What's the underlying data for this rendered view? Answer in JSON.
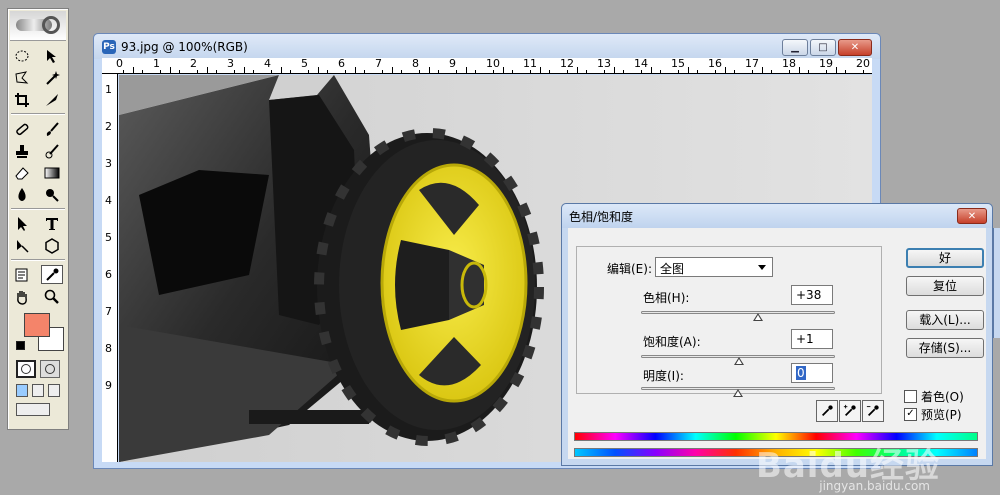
{
  "document": {
    "title": "93.jpg @ 100%(RGB)",
    "ruler_h": [
      "0",
      "1",
      "2",
      "3",
      "4",
      "5",
      "6",
      "7",
      "8",
      "9",
      "10",
      "11",
      "12",
      "13",
      "14",
      "15",
      "16",
      "17",
      "18",
      "19",
      "20"
    ],
    "ruler_v": [
      "1",
      "2",
      "3",
      "4",
      "5",
      "6",
      "7",
      "8",
      "9"
    ]
  },
  "toolbox": {
    "foreground_color": "#f4846a",
    "background_color": "#ffffff"
  },
  "dialog": {
    "title": "色相/饱和度",
    "edit_label": "编辑(E):",
    "edit_value": "全图",
    "hue_label": "色相(H):",
    "hue_value": "+38",
    "hue_level": 38,
    "saturation_label": "饱和度(A):",
    "saturation_value": "+1",
    "saturation_level": 1,
    "lightness_label": "明度(I):",
    "lightness_value": "0",
    "lightness_level": 0,
    "ok_label": "好",
    "reset_label": "复位",
    "load_label": "载入(L)...",
    "save_label": "存储(S)...",
    "colorize_label": "着色(O)",
    "colorize_checked": false,
    "preview_label": "预览(P)",
    "preview_checked": true
  },
  "watermark": {
    "text": "Baidu经验",
    "sub": "jingyan.baidu.com"
  },
  "colors": {
    "wheel_yellow": "#f2e01c",
    "tire": "#1c1c1c"
  },
  "icons": {
    "doc": "photoshop-doc-icon",
    "close": "close-icon",
    "minimize": "minimize-icon",
    "maximize": "maximize-icon"
  }
}
